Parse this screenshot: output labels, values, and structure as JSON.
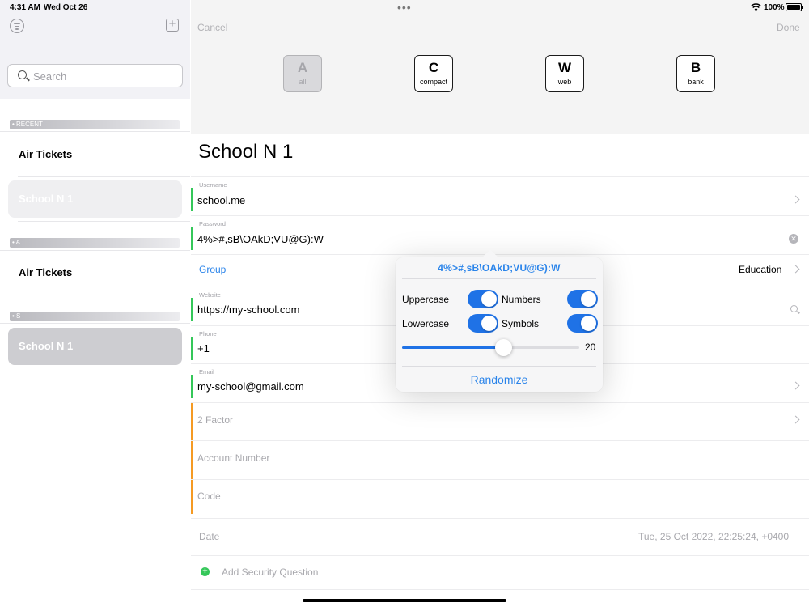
{
  "status_bar": {
    "time": "4:31 AM",
    "date": "Wed Oct 26",
    "dots": "•••",
    "battery": "100%"
  },
  "sidebar": {
    "search_placeholder": "Search",
    "sections": [
      {
        "title": "• RECENT",
        "items": [
          "Air Tickets",
          "School N 1"
        ]
      },
      {
        "title": "• A",
        "items": [
          "Air Tickets"
        ]
      },
      {
        "title": "• S",
        "items": [
          "School N 1"
        ]
      }
    ]
  },
  "header": {
    "cancel": "Cancel",
    "done": "Done",
    "categories": [
      {
        "letter": "A",
        "label": "all",
        "enabled": false
      },
      {
        "letter": "C",
        "label": "compact",
        "enabled": true
      },
      {
        "letter": "W",
        "label": "web",
        "enabled": true
      },
      {
        "letter": "B",
        "label": "bank",
        "enabled": true
      }
    ]
  },
  "entry": {
    "title": "School N 1",
    "username_label": "Username",
    "username": "school.me",
    "password_label": "Password",
    "password": "4%>#,sB\\OAkD;VU@G):W",
    "group_label": "Group",
    "group_value": "Education",
    "website_label": "Website",
    "website": "https://my-school.com",
    "phone_label": "Phone",
    "phone": "+1",
    "email_label": "Email",
    "email": "my-school@gmail.com",
    "two_factor_placeholder": "2 Factor",
    "account_number_placeholder": "Account Number",
    "code_placeholder": "Code",
    "date_label": "Date",
    "date_value": "Tue, 25 Oct 2022, 22:25:24, +0400",
    "add_security_question": "Add Security Question"
  },
  "generator": {
    "password": "4%>#,sB\\OAkD;VU@G):W",
    "uppercase_label": "Uppercase",
    "numbers_label": "Numbers",
    "lowercase_label": "Lowercase",
    "symbols_label": "Symbols",
    "uppercase_on": true,
    "numbers_on": true,
    "lowercase_on": true,
    "symbols_on": true,
    "length": "20",
    "length_fraction": 0.57,
    "randomize": "Randomize"
  },
  "colors": {
    "accent": "#2a84ea",
    "toggle_on": "#1f72e6",
    "field_filled": "#34c759",
    "field_empty": "#f59a23"
  }
}
